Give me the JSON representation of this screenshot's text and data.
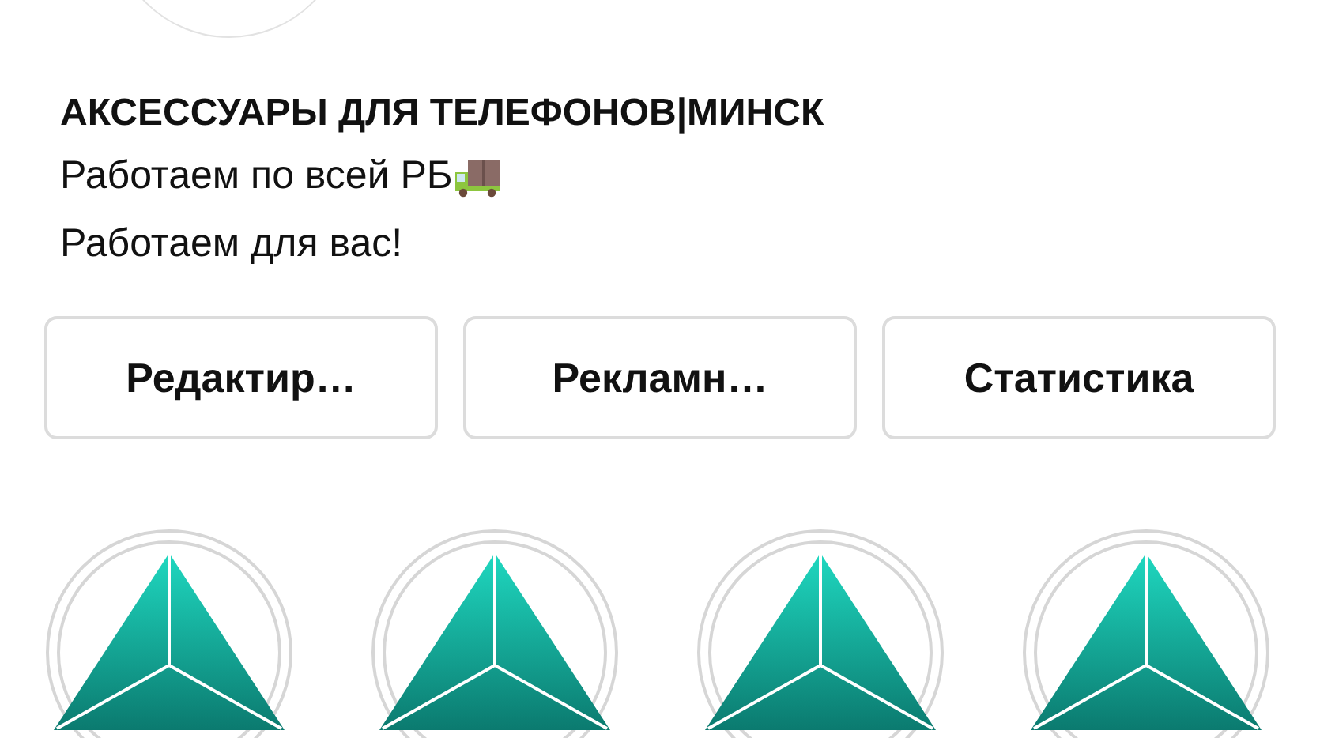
{
  "profile": {
    "name": "АКСЕССУАРЫ ДЛЯ ТЕЛЕФОНОВ|МИНСК",
    "bio": [
      {
        "text": "Работаем по всей РБ",
        "kind": "with-icon"
      },
      {
        "text": "Работаем для вас!",
        "kind": "plain"
      }
    ]
  },
  "buttons": [
    "Редактир…",
    "Рекламн…",
    "Статистика"
  ],
  "highlights": [
    {
      "kind": "triangle-logo"
    },
    {
      "kind": "triangle-logo"
    },
    {
      "kind": "triangle-logo"
    },
    {
      "kind": "triangle-logo"
    }
  ]
}
